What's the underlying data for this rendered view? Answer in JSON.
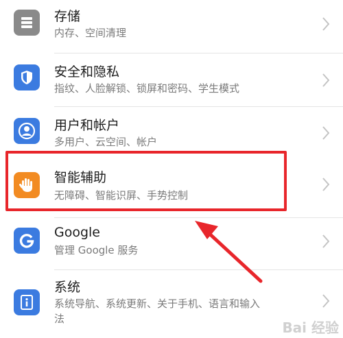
{
  "settings": {
    "items": [
      {
        "title": "存储",
        "subtitle": "内存、空间清理",
        "icon": "storage-icon",
        "color": "#8a8a8a"
      },
      {
        "title": "安全和隐私",
        "subtitle": "指纹、人脸解锁、锁屏和密码、学生模式",
        "icon": "shield-icon",
        "color": "#3b7be0"
      },
      {
        "title": "用户和帐户",
        "subtitle": "多用户、云空间、帐户",
        "icon": "user-icon",
        "color": "#3b7be0"
      },
      {
        "title": "智能辅助",
        "subtitle": "无障碍、智能识屏、手势控制",
        "icon": "hand-icon",
        "color": "#f28b22"
      },
      {
        "title": "Google",
        "subtitle": "管理 Google 服务",
        "icon": "google-icon",
        "color": "#3b7be0"
      },
      {
        "title": "系统",
        "subtitle": "系统导航、系统更新、关于手机、语言和输入",
        "subtitle2": "法",
        "icon": "info-icon",
        "color": "#3b7be0"
      }
    ]
  },
  "annotation": {
    "highlight_color": "#e8262b"
  },
  "watermark": {
    "text": "Bai 经验"
  }
}
